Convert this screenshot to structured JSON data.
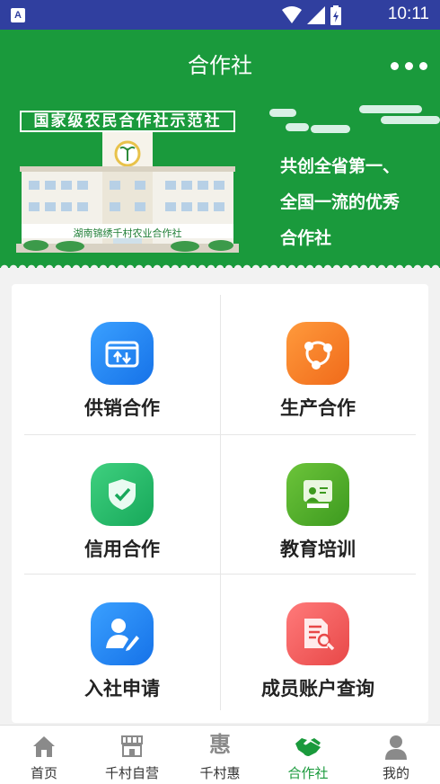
{
  "status_bar": {
    "app_icon": "A",
    "time": "10:11",
    "icons": [
      "wifi-icon",
      "signal-icon",
      "battery-icon"
    ]
  },
  "header": {
    "title": "合作社",
    "more_icon": "more-dots-icon"
  },
  "banner": {
    "sign": "国家级农民合作社示范社",
    "building_label": "湖南锦绣千村农业合作社",
    "tagline": [
      "共创全省第一、",
      "全国一流的优秀",
      "合作社"
    ]
  },
  "grid": [
    {
      "label": "供销合作",
      "icon": "box-transfer-icon",
      "color_from": "#3aa0ff",
      "color_to": "#1672e8"
    },
    {
      "label": "生产合作",
      "icon": "network-icon",
      "color_from": "#ff9a3c",
      "color_to": "#f06a1a"
    },
    {
      "label": "信用合作",
      "icon": "shield-check-icon",
      "color_from": "#3fd07f",
      "color_to": "#17a85a"
    },
    {
      "label": "教育培训",
      "icon": "teacher-board-icon",
      "color_from": "#6cc43a",
      "color_to": "#3d9a1f"
    },
    {
      "label": "入社申请",
      "icon": "user-edit-icon",
      "color_from": "#3aa0ff",
      "color_to": "#1672e8"
    },
    {
      "label": "成员账户查询",
      "icon": "document-search-icon",
      "color_from": "#ff7a7a",
      "color_to": "#e84848"
    }
  ],
  "bottom_nav": [
    {
      "label": "首页",
      "icon": "home-icon",
      "active": false
    },
    {
      "label": "千村自营",
      "icon": "shop-icon",
      "active": false
    },
    {
      "label": "千村惠",
      "icon": "hui-icon",
      "glyph": "惠",
      "active": false
    },
    {
      "label": "合作社",
      "icon": "handshake-icon",
      "active": true
    },
    {
      "label": "我的",
      "icon": "person-icon",
      "active": false
    }
  ],
  "colors": {
    "primary_green": "#1a9a3c",
    "status_bar": "#303f9f"
  }
}
